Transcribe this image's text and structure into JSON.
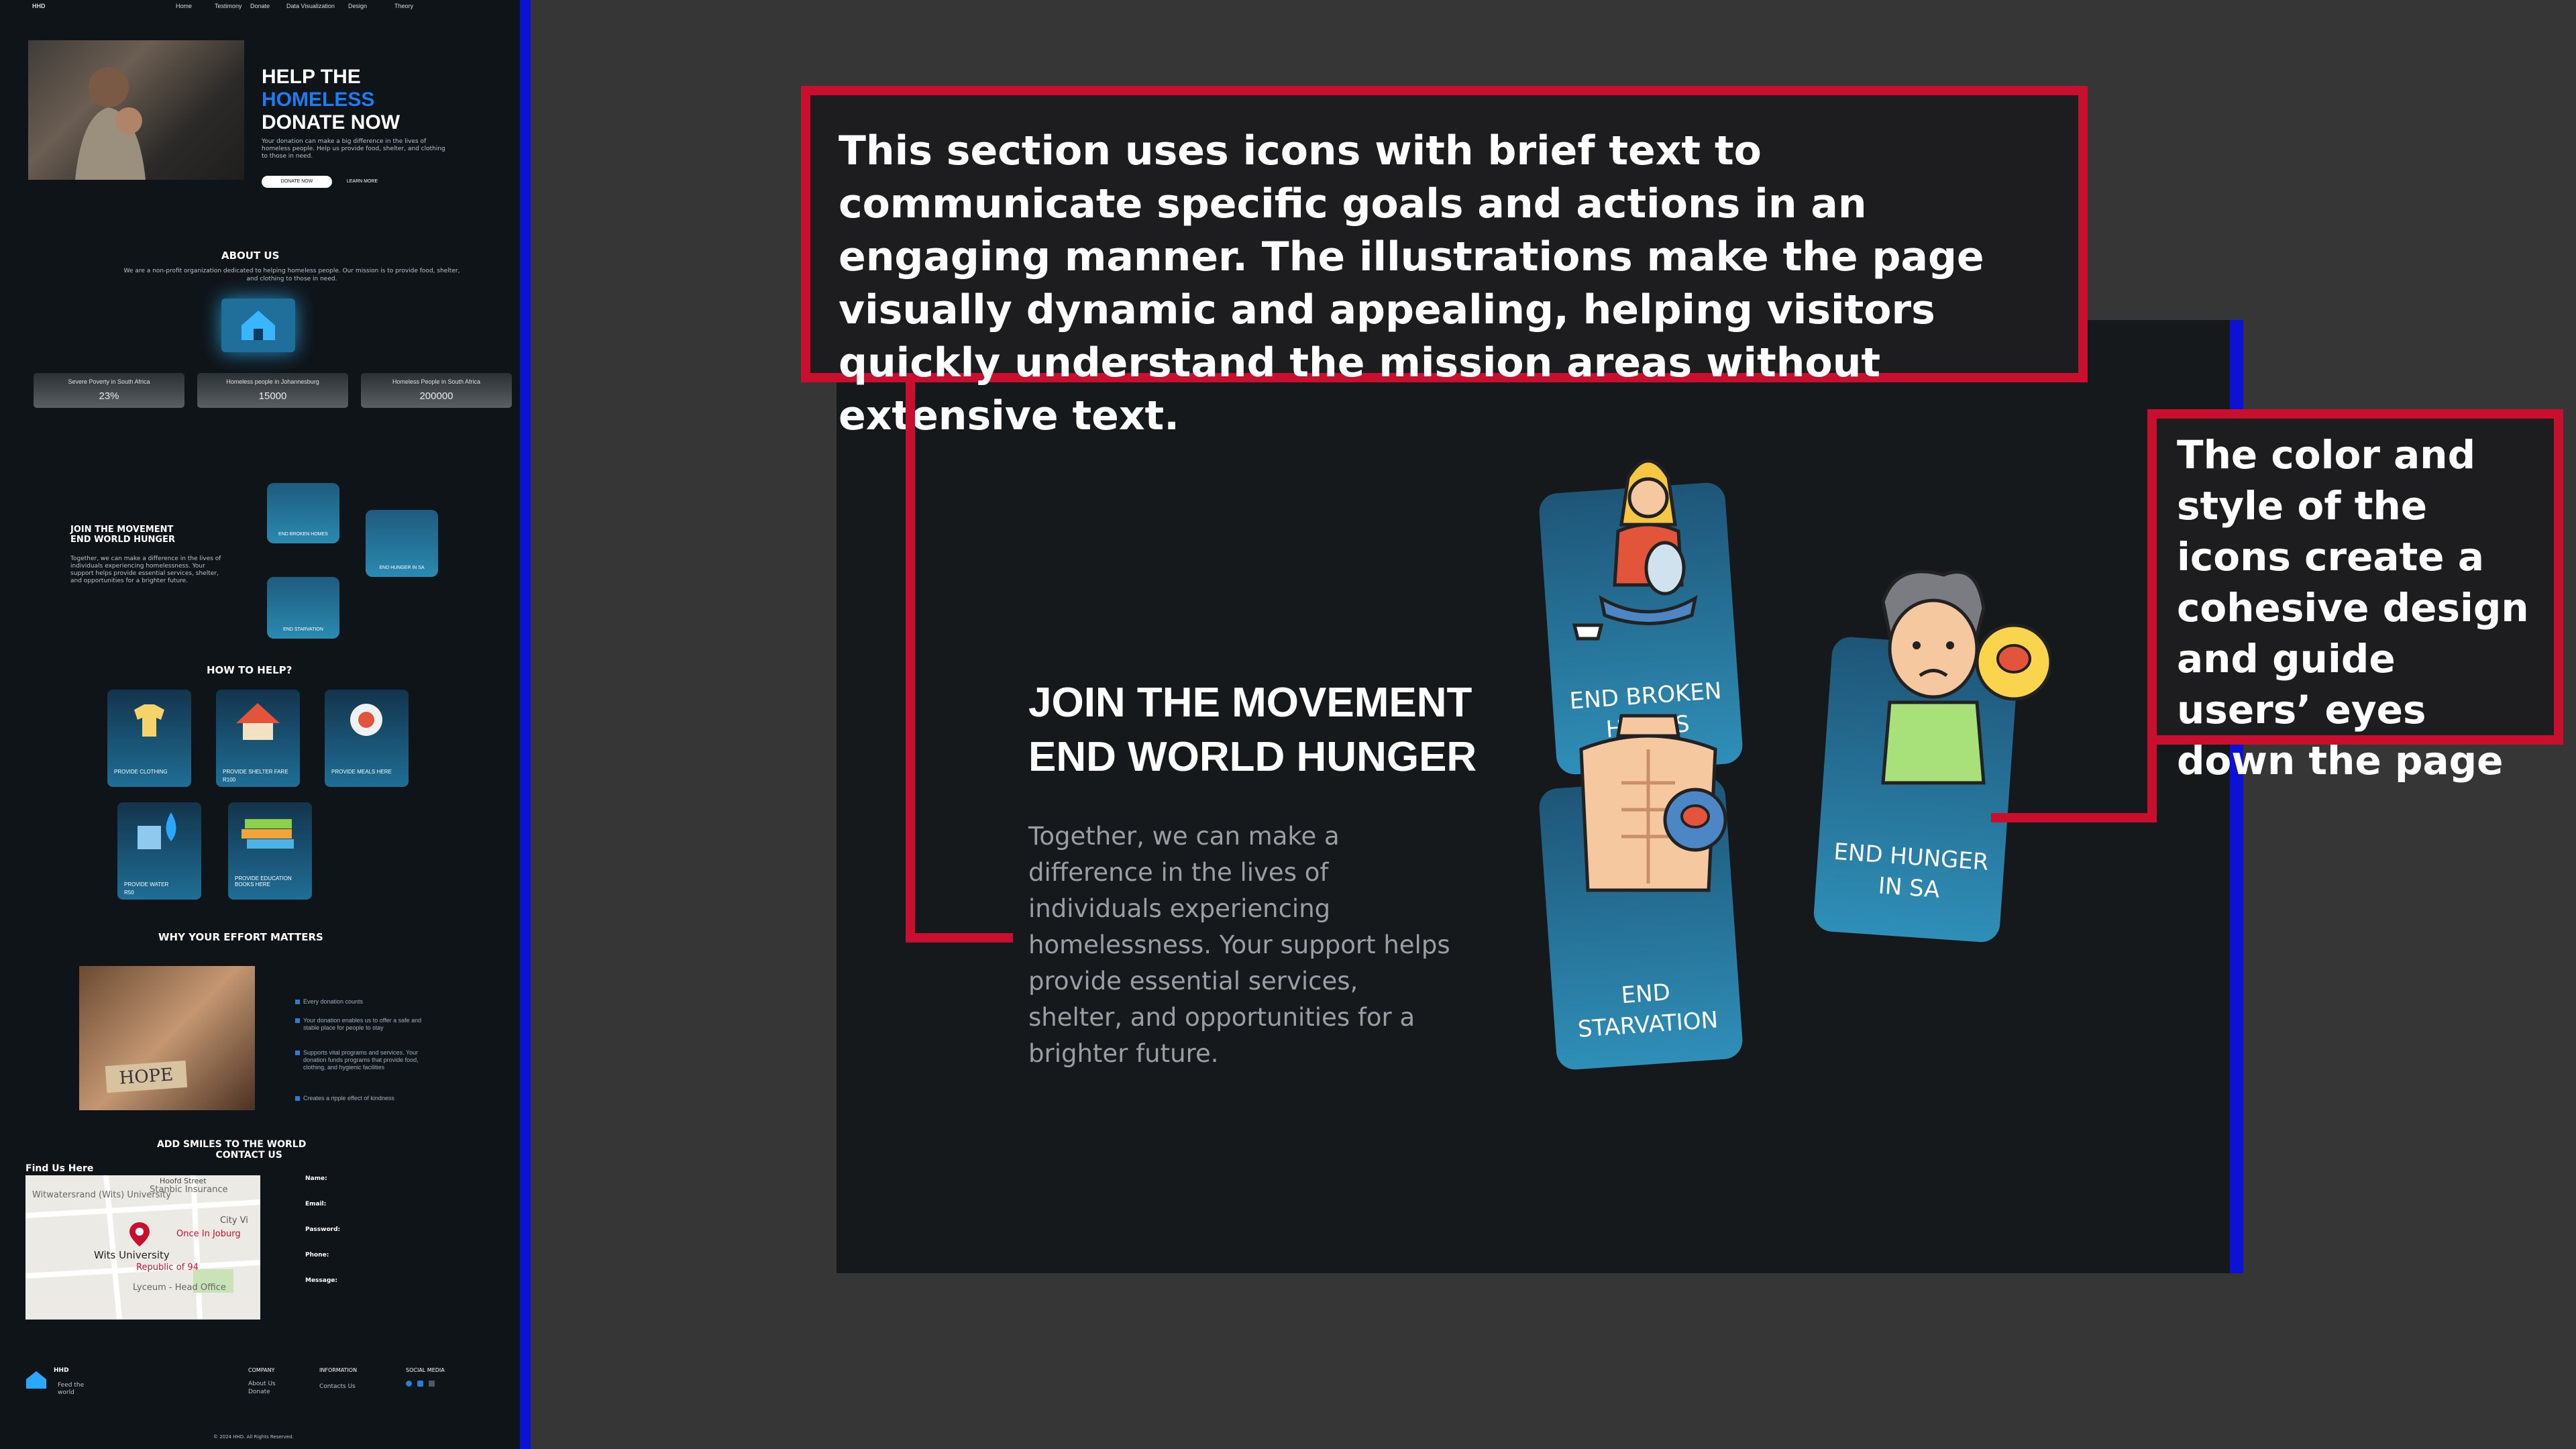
{
  "nav": {
    "logo": "HHD",
    "items": [
      "Home",
      "Testimony",
      "Donate",
      "Data Visualization",
      "Design",
      "Theory"
    ]
  },
  "hero": {
    "line1": "HELP THE",
    "line2": "HOMELESS",
    "line3": "DONATE NOW",
    "body": "Your donation can make a big difference in the lives of homeless people. Help us provide food, shelter, and clothing to those in need.",
    "donate_btn": "DONATE NOW",
    "learn_btn": "LEARN MORE"
  },
  "about": {
    "title": "ABOUT US",
    "body": "We are a non-profit organization dedicated to helping homeless people. Our mission is to provide food, shelter, and clothing to those in need.",
    "stats": [
      {
        "label": "Severe Poverty in South Africa",
        "value": "23%"
      },
      {
        "label": "Homeless people in Johannesburg",
        "value": "15000"
      },
      {
        "label": "Homeless People in South Africa",
        "value": "200000"
      }
    ]
  },
  "movement": {
    "line1": "JOIN THE MOVEMENT",
    "line2": "END WORLD HUNGER",
    "body": "Together, we can make a difference in the lives of individuals experiencing homelessness. Your support helps provide essential services, shelter, and opportunities for a brighter future.",
    "cards": [
      "END BROKEN HOMES",
      "END HUNGER IN SA",
      "END STARVATION"
    ]
  },
  "help": {
    "title": "HOW TO HELP?",
    "items": [
      {
        "label": "PROVIDE CLOTHING",
        "price": ""
      },
      {
        "label": "PROVIDE SHELTER FARE",
        "price": "R100"
      },
      {
        "label": "PROVIDE MEALS HERE",
        "price": ""
      },
      {
        "label": "PROVIDE WATER",
        "price": "R50"
      },
      {
        "label": "PROVIDE EDUCATION BOOKS HERE",
        "price": ""
      }
    ]
  },
  "why": {
    "title": "WHY YOUR EFFORT MATTERS",
    "photo_sign": "HOPE",
    "bullets": [
      "Every donation counts",
      "Your donation enables us to offer a safe and stable place for people to stay",
      "Supports vital programs and services. Your donation funds programs that provide food, clothing, and hygienic facilities",
      "Creates a ripple effect of kindness"
    ]
  },
  "contact": {
    "title1": "ADD SMILES TO THE WORLD",
    "title2": "CONTACT US",
    "map_title": "Find Us Here",
    "map_labels": [
      "Wits University",
      "Stanbic Insurance",
      "Witwatersrand (Wits) University",
      "Once In Joburg",
      "Republic of 94",
      "Hoofd Street",
      "City Vi",
      "Lyceum - Head Office"
    ],
    "fields": [
      "Name:",
      "Email:",
      "Password:",
      "Phone:",
      "Message:"
    ]
  },
  "footer": {
    "logo": "HHD",
    "tagline": "Feed the world",
    "company": "COMPANY",
    "company_links": [
      "About Us",
      "Donate"
    ],
    "information": "INFORMATION",
    "info_links": [
      "Contacts Us"
    ],
    "social": "SOCIAL MEDIA",
    "copyright": "© 2024 HHD. All Rights Reserved."
  },
  "callouts": {
    "top": "This section uses icons with brief text to communicate specific goals and actions in an engaging manner. The illustrations make the page visually dynamic and appealing, helping visitors quickly understand the mission areas without extensive text.",
    "right": "The color and style of the icons create a cohesive design and guide users’ eyes down the page"
  },
  "colors": {
    "accent_blue": "#1c7cf2",
    "callout_red": "#c8102e",
    "card_teal": "#2f8fb8",
    "page_bg": "#363636"
  }
}
